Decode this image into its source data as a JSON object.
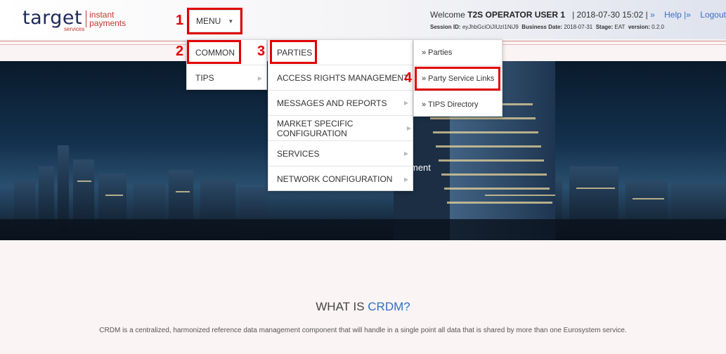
{
  "logo": {
    "word": "target",
    "sub": "services",
    "line1": "instant",
    "line2": "payments"
  },
  "menu": {
    "label": "MENU",
    "caret": "▼"
  },
  "user": {
    "welcome": "Welcome",
    "name": "T2S OPERATOR USER 1",
    "datetime": "| 2018-07-30 15:02 |",
    "sep1": "»",
    "help": "Help",
    "sep2": "|»",
    "logout": "Logout"
  },
  "session": {
    "id_label": "Session ID:",
    "id_value": "eyJhbGciOiJIUzI1NiJ9",
    "bdate_label": "Business Date:",
    "bdate_value": "2018-07-31",
    "stage_label": "Stage:",
    "stage_value": "EAT",
    "version_label": "version:",
    "version_value": "0.2.0"
  },
  "annotations": [
    "1",
    "2",
    "3",
    "4"
  ],
  "dropdown1": {
    "items": [
      "COMMON",
      "TIPS"
    ]
  },
  "dropdown2": {
    "items": [
      "PARTIES",
      "ACCESS RIGHTS MANAGEMENT",
      "MESSAGES AND REPORTS",
      "MARKET SPECIFIC CONFIGURATION",
      "SERVICES",
      "NETWORK CONFIGURATION"
    ]
  },
  "dropdown3": {
    "items": [
      "» Parties",
      "» Party Service Links",
      "» TIPS Directory"
    ]
  },
  "hero": {
    "text": "ment"
  },
  "about": {
    "what": "WHAT IS",
    "crdm": "CRDM?",
    "description": "CRDM is a centralized, harmonized reference data management component that will handle in a single point all data that is shared by more than one Eurosystem service."
  },
  "colors": {
    "annotation": "#e00000",
    "link": "#3a6ec2",
    "crdm": "#2f6fbf",
    "logo": "#1e2a5a",
    "logo_accent": "#c0392b"
  },
  "icons": [
    "dropdown-caret-icon",
    "submenu-arrow-icon"
  ]
}
